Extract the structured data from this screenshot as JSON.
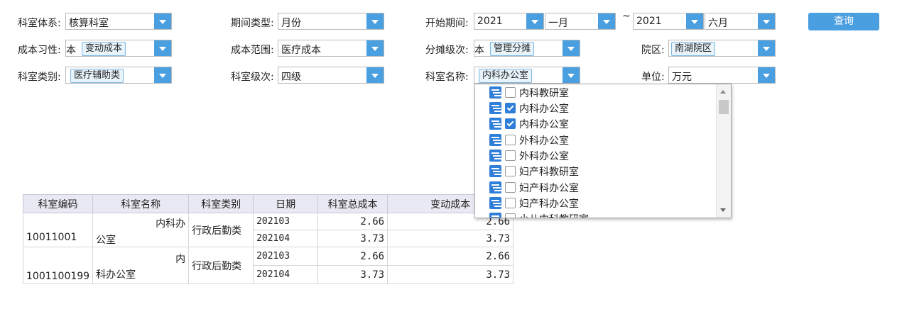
{
  "filters": {
    "dept_system": {
      "label": "科室体系:",
      "value": "核算科室"
    },
    "period_type": {
      "label": "期间类型:",
      "value": "月份"
    },
    "start_period": {
      "label": "开始期间:",
      "year_from": "2021",
      "month_from": "一月",
      "tilde": "~",
      "year_to": "2021",
      "month_to": "六月"
    },
    "query_button": "查询",
    "cost_habit": {
      "label": "成本习性:",
      "prefix": "本",
      "tag": "变动成本"
    },
    "cost_scope": {
      "label": "成本范围:",
      "value": "医疗成本"
    },
    "alloc_level": {
      "label": "分摊级次:",
      "prefix": "本",
      "tag": "管理分摊"
    },
    "campus": {
      "label": "院区:",
      "tag": "南湖院区"
    },
    "dept_category": {
      "label": "科室类别:",
      "tag": "医疗辅助类"
    },
    "dept_level": {
      "label": "科室级次:",
      "value": "四级"
    },
    "dept_name": {
      "label": "科室名称:",
      "tag": "内科办公室"
    },
    "unit": {
      "label": "单位:",
      "value": "万元"
    }
  },
  "dropdown": {
    "items": [
      {
        "label": "内科教研室",
        "checked": false
      },
      {
        "label": "内科办公室",
        "checked": true
      },
      {
        "label": "内科办公室",
        "checked": true
      },
      {
        "label": "外科办公室",
        "checked": false
      },
      {
        "label": "外科办公室",
        "checked": false
      },
      {
        "label": "妇产科教研室",
        "checked": false
      },
      {
        "label": "妇产科办公室",
        "checked": false
      },
      {
        "label": "妇产科办公室",
        "checked": false
      },
      {
        "label": "小儿内科教研室",
        "checked": false
      }
    ]
  },
  "table": {
    "headers": [
      "科室编码",
      "科室名称",
      "科室类别",
      "日期",
      "科室总成本",
      "变动成本"
    ],
    "groups": [
      {
        "code": "10011001",
        "name_line1": "内科办",
        "name_line2": "公室",
        "category": "行政后勤类",
        "rows": [
          {
            "date": "202103",
            "total": "2.66",
            "variable": "2.66"
          },
          {
            "date": "202104",
            "total": "3.73",
            "variable": "3.73"
          }
        ]
      },
      {
        "code": "1001100199",
        "name_line1": "内",
        "name_line2": "科办公室",
        "category": "行政后勤类",
        "rows": [
          {
            "date": "202103",
            "total": "2.66",
            "variable": "2.66"
          },
          {
            "date": "202104",
            "total": "3.73",
            "variable": "3.73"
          }
        ]
      }
    ]
  }
}
